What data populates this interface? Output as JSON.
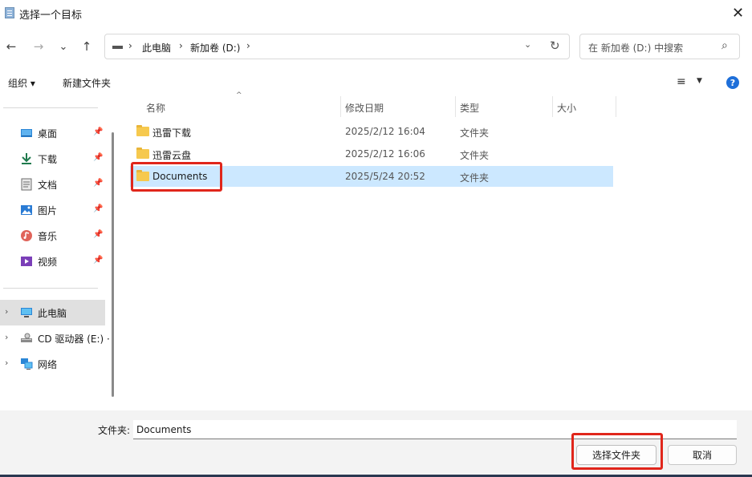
{
  "window": {
    "title": "选择一个目标",
    "close_glyph": "✕"
  },
  "nav": {
    "back": "←",
    "forward": "→",
    "recent": "⌄",
    "up": "↑"
  },
  "address": {
    "sep": "›",
    "crumbs": [
      "此电脑",
      "新加卷 (D:)"
    ],
    "dropdown": "⌄",
    "refresh": "↻"
  },
  "search": {
    "placeholder": "在 新加卷 (D:) 中搜索",
    "icon": "⌕"
  },
  "toolbar": {
    "organize": "组织 ▾",
    "new_folder": "新建文件夹",
    "view_icon": "≡",
    "view_dd": "▼",
    "help": "?"
  },
  "sidebar": {
    "quick_access": [
      {
        "label": "桌面",
        "icon": "desktop-icon"
      },
      {
        "label": "下载",
        "icon": "download-icon"
      },
      {
        "label": "文档",
        "icon": "document-icon"
      },
      {
        "label": "图片",
        "icon": "picture-icon"
      },
      {
        "label": "音乐",
        "icon": "music-icon"
      },
      {
        "label": "视频",
        "icon": "video-icon"
      }
    ],
    "pin_glyph": "📌",
    "chevron": "›",
    "tree": [
      {
        "label": "此电脑",
        "icon": "computer-icon",
        "selected": true
      },
      {
        "label": "CD 驱动器 (E:) ·",
        "icon": "cd-drive-icon"
      },
      {
        "label": "网络",
        "icon": "network-icon"
      }
    ]
  },
  "columns": {
    "name": "名称",
    "modified": "修改日期",
    "type": "类型",
    "size": "大小",
    "sort_indicator": "^"
  },
  "files": [
    {
      "name": "迅雷下载",
      "modified": "2025/2/12 16:04",
      "type": "文件夹"
    },
    {
      "name": "迅雷云盘",
      "modified": "2025/2/12 16:06",
      "type": "文件夹"
    },
    {
      "name": "Documents",
      "modified": "2025/5/24 20:52",
      "type": "文件夹",
      "selected": true
    }
  ],
  "footer": {
    "folder_label": "文件夹:",
    "folder_value": "Documents",
    "select_button": "选择文件夹",
    "cancel_button": "取消"
  },
  "colors": {
    "accent": "#1e6fd9",
    "selection": "#cce8ff",
    "highlight": "#e0261b"
  }
}
